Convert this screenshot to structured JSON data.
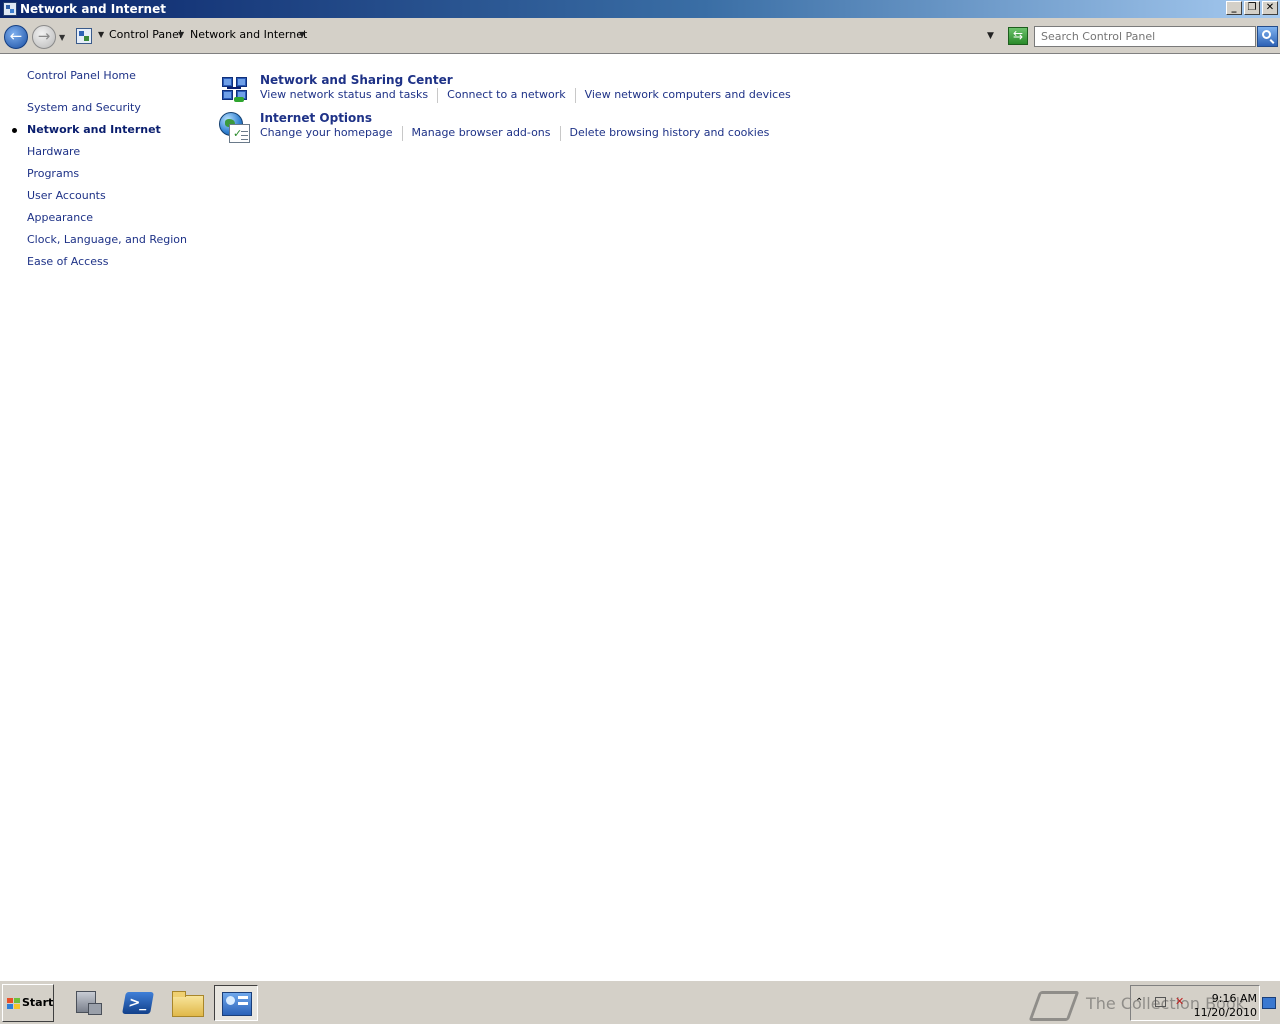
{
  "window": {
    "title": "Network and Internet",
    "buttons": {
      "minimize": "_",
      "restore": "❐",
      "close": "✕"
    }
  },
  "address_bar": {
    "back_glyph": "←",
    "forward_glyph": "→",
    "breadcrumbs": [
      "Control Panel",
      "Network and Internet"
    ],
    "refresh_glyph": "⇆",
    "search_placeholder": "Search Control Panel"
  },
  "left_nav": {
    "home": "Control Panel Home",
    "items": [
      {
        "label": "System and Security"
      },
      {
        "label": "Network and Internet",
        "current": true
      },
      {
        "label": "Hardware"
      },
      {
        "label": "Programs"
      },
      {
        "label": "User Accounts"
      },
      {
        "label": "Appearance"
      },
      {
        "label": "Clock, Language, and Region"
      },
      {
        "label": "Ease of Access"
      }
    ]
  },
  "categories": [
    {
      "title": "Network and Sharing Center",
      "icon": "network-sharing-icon",
      "links": [
        "View network status and tasks",
        "Connect to a network",
        "View network computers and devices"
      ]
    },
    {
      "title": "Internet Options",
      "icon": "internet-options-icon",
      "links": [
        "Change your homepage",
        "Manage browser add-ons",
        "Delete browsing history and cookies"
      ]
    }
  ],
  "taskbar": {
    "start_label": "Start",
    "apps": [
      "server-manager-icon",
      "powershell-icon",
      "explorer-icon",
      "control-panel-icon"
    ],
    "active_app": "control-panel-icon",
    "clock_time": "9:16 AM",
    "clock_date": "11/20/2010",
    "watermark": "The Collection Book"
  },
  "colors": {
    "link": "#1e3287",
    "titlebar_start": "#0a246a",
    "titlebar_end": "#a6caf0",
    "chrome": "#d4d0c8"
  }
}
